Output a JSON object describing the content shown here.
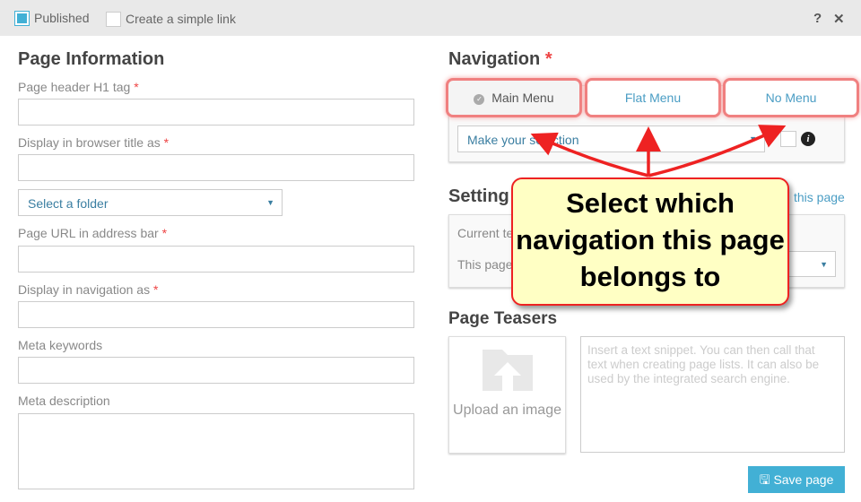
{
  "topbar": {
    "published_label": "Published",
    "published_checked": true,
    "simple_link_label": "Create a simple link",
    "help": "?",
    "close": "✕"
  },
  "page_info": {
    "title": "Page Information",
    "required_mark": "*",
    "fields": [
      {
        "label": "Page header H1 tag",
        "required": true
      },
      {
        "label": "Display in browser title as",
        "required": true
      },
      {
        "label": "Page URL in address bar",
        "required": true
      },
      {
        "label": "Display in navigation as",
        "required": true
      },
      {
        "label": "Meta keywords"
      },
      {
        "label": "Meta description"
      }
    ],
    "folder_select": "Select a folder"
  },
  "navigation": {
    "title": "Navigation",
    "required_mark": "*",
    "tabs": [
      {
        "label": "Main Menu",
        "active": true
      },
      {
        "label": "Flat Menu"
      },
      {
        "label": "No Menu"
      }
    ],
    "select": "Make your selection"
  },
  "settings": {
    "title": "Setting",
    "link": "this page",
    "current_label": "Current te",
    "this_page_label": "This page"
  },
  "teasers": {
    "title": "Page Teasers",
    "upload": "Upload an image",
    "snippet_placeholder": "Insert a text snippet. You can then call that text when creating page lists. It can also be used by the integrated search engine."
  },
  "save_button": "Save page",
  "callout": {
    "text": "Select which navigation this page belongs to"
  },
  "colors": {
    "accent": "#42b0d5",
    "annotation": "#e22222",
    "callout_bg": "#ffffc4"
  }
}
